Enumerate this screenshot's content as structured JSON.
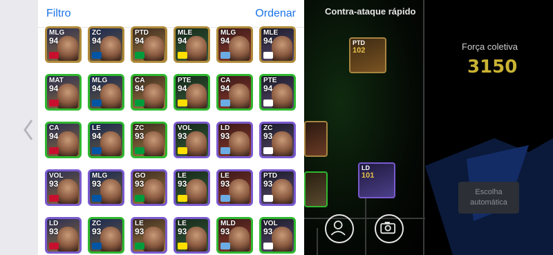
{
  "header": {
    "filter_label": "Filtro",
    "sort_label": "Ordenar"
  },
  "players": [
    {
      "pos": "MLG",
      "ovr": "94"
    },
    {
      "pos": "ZC",
      "ovr": "94"
    },
    {
      "pos": "PTD",
      "ovr": "94"
    },
    {
      "pos": "MLE",
      "ovr": "94"
    },
    {
      "pos": "MLG",
      "ovr": "94"
    },
    {
      "pos": "MLE",
      "ovr": "94"
    },
    {
      "pos": "MAT",
      "ovr": "94"
    },
    {
      "pos": "MLG",
      "ovr": "94"
    },
    {
      "pos": "CA",
      "ovr": "94"
    },
    {
      "pos": "PTE",
      "ovr": "94"
    },
    {
      "pos": "CA",
      "ovr": "94"
    },
    {
      "pos": "PTE",
      "ovr": "94"
    },
    {
      "pos": "CA",
      "ovr": "94"
    },
    {
      "pos": "LE",
      "ovr": "94"
    },
    {
      "pos": "ZC",
      "ovr": "93"
    },
    {
      "pos": "VOL",
      "ovr": "93"
    },
    {
      "pos": "LD",
      "ovr": "93"
    },
    {
      "pos": "ZC",
      "ovr": "93"
    },
    {
      "pos": "VOL",
      "ovr": "93"
    },
    {
      "pos": "MLG",
      "ovr": "93"
    },
    {
      "pos": "GO",
      "ovr": "93"
    },
    {
      "pos": "LE",
      "ovr": "93"
    },
    {
      "pos": "LE",
      "ovr": "93"
    },
    {
      "pos": "PTD",
      "ovr": "93"
    },
    {
      "pos": "LD",
      "ovr": "93"
    },
    {
      "pos": "ZC",
      "ovr": "93"
    },
    {
      "pos": "LE",
      "ovr": "93"
    },
    {
      "pos": "LE",
      "ovr": "93"
    },
    {
      "pos": "MLD",
      "ovr": "93"
    },
    {
      "pos": "VOL",
      "ovr": "93"
    }
  ],
  "field": {
    "tactic_label": "Contra-ataque rápido",
    "card_top": {
      "pos": "PTD",
      "ovr": "102"
    },
    "card_mid": {
      "pos": "LD",
      "ovr": "101"
    }
  },
  "team": {
    "strength_label": "Força coletiva",
    "strength_value": "3150",
    "auto_select_label": "Escolha automática"
  },
  "colors": {
    "accent": "#1a73e8",
    "strength": "#c9b233",
    "card_border_gold": "#b08b3a",
    "card_border_green": "#2fb82f",
    "card_border_purple": "#7a5acf"
  }
}
